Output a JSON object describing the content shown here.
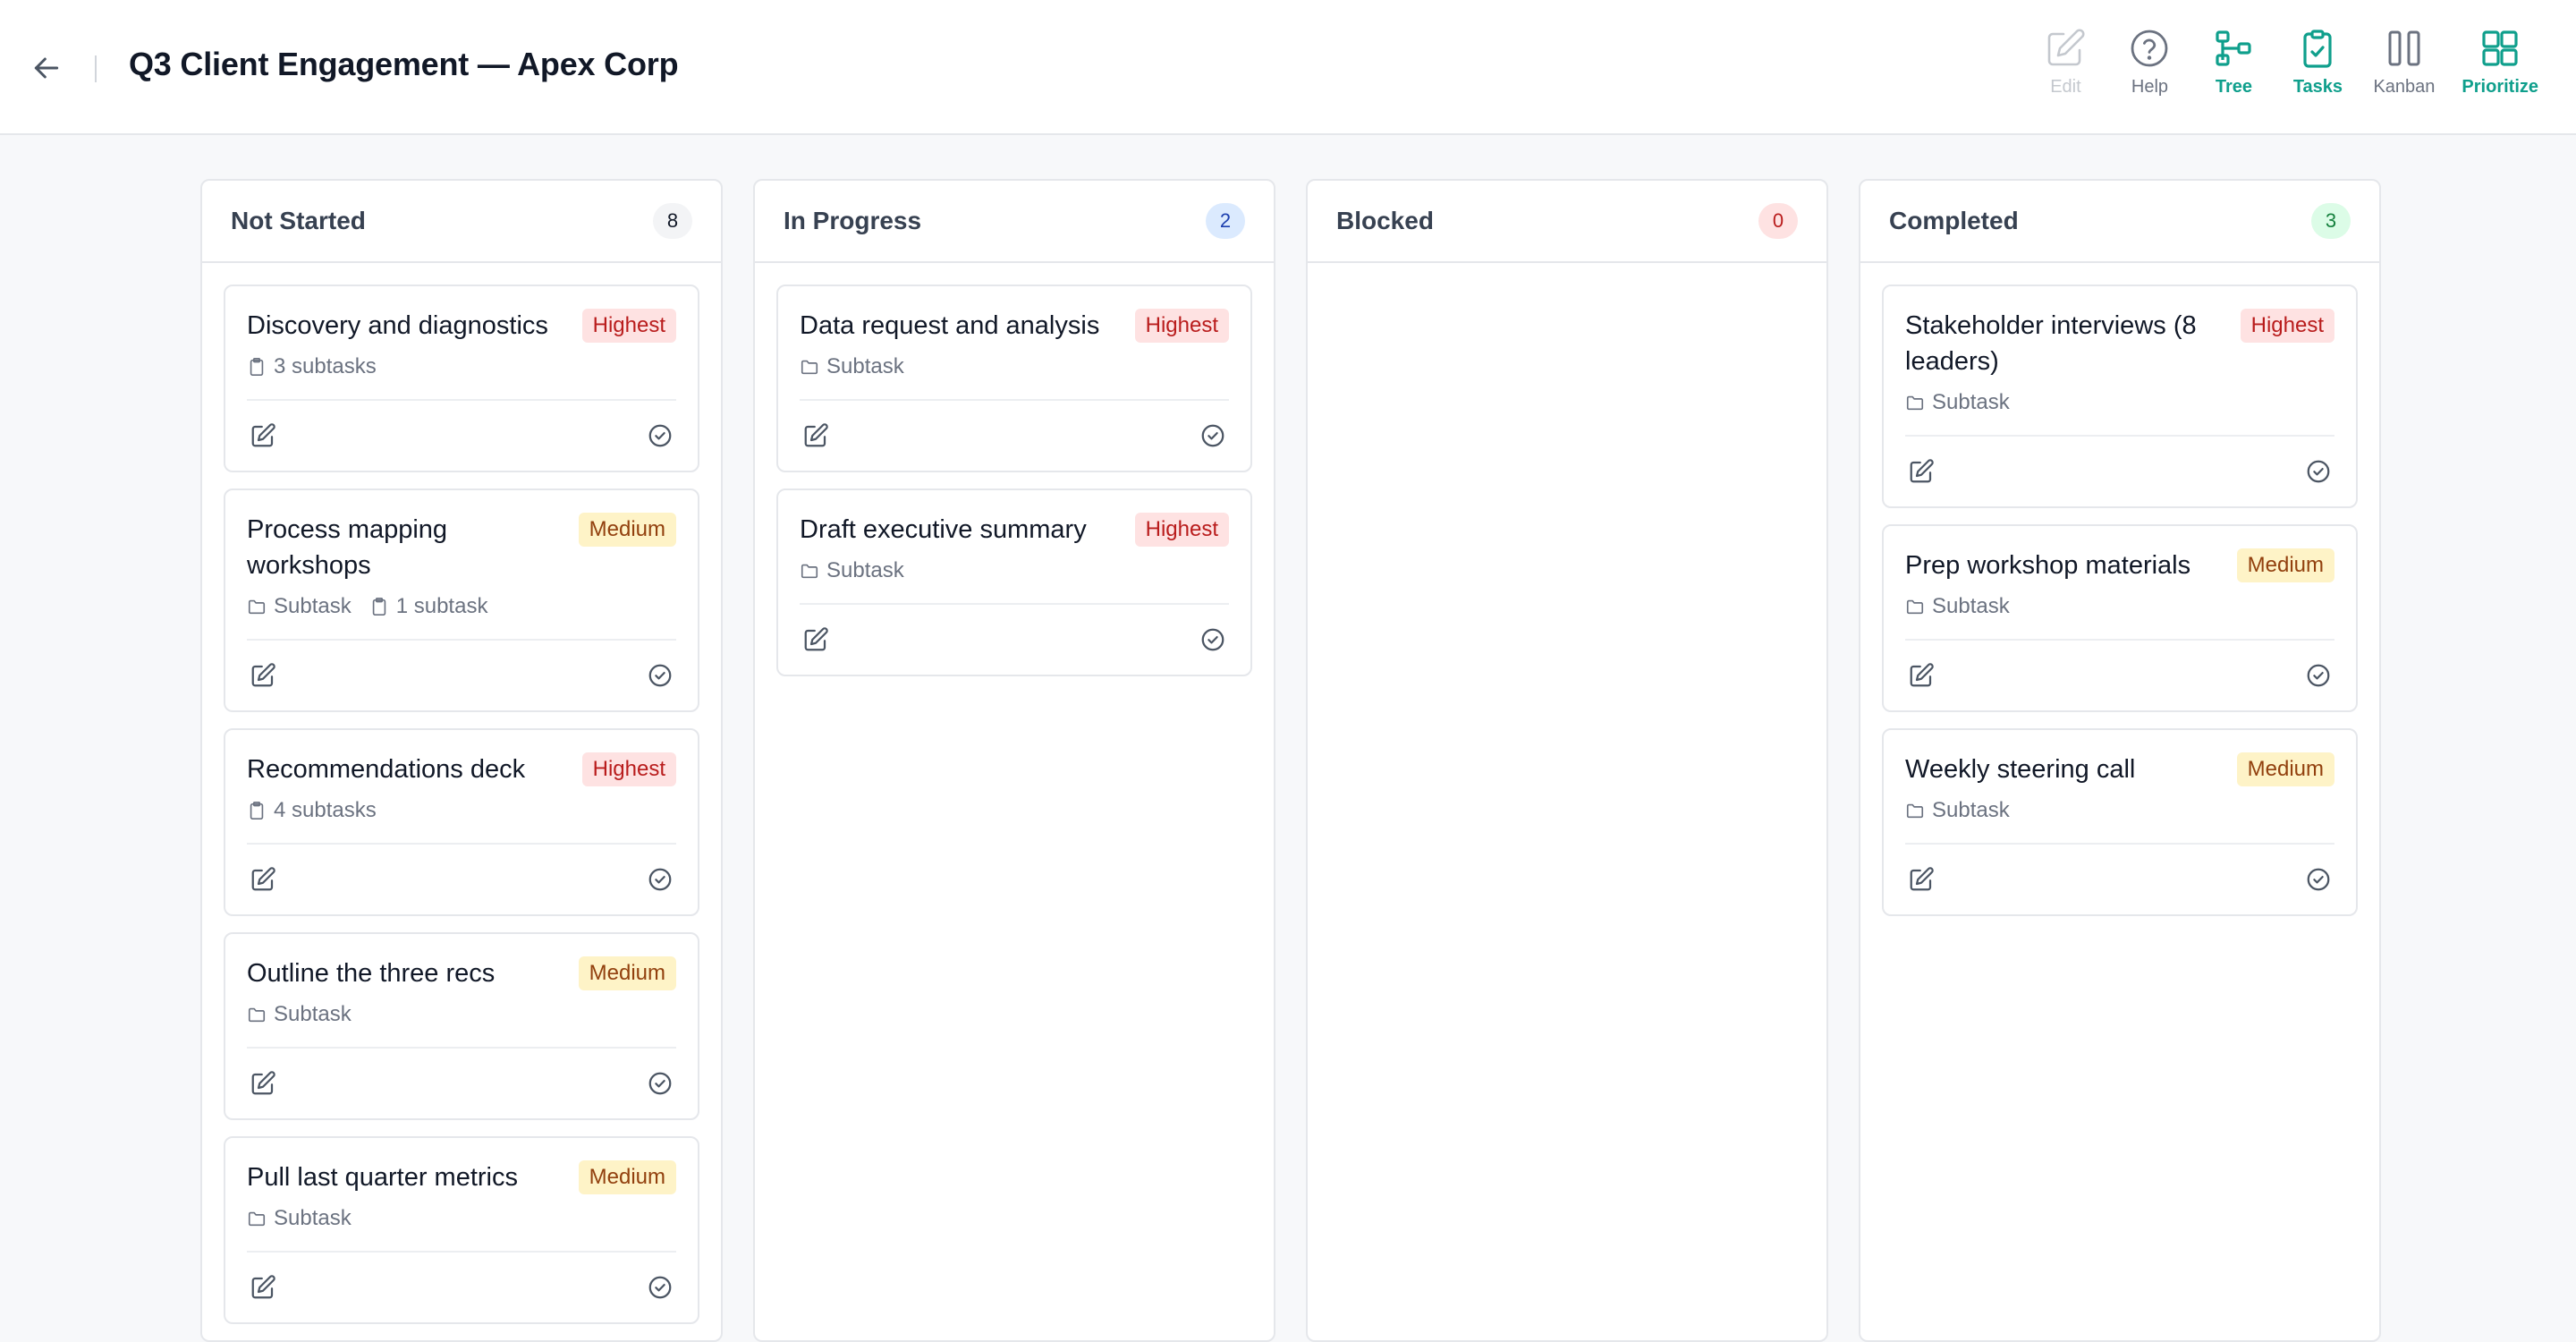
{
  "header": {
    "title": "Q3 Client Engagement — Apex Corp",
    "toolbar": [
      {
        "label": "Edit",
        "icon": "edit-icon",
        "state": "disabled"
      },
      {
        "label": "Help",
        "icon": "help-icon",
        "state": "normal"
      },
      {
        "label": "Tree",
        "icon": "tree-icon",
        "state": "accent"
      },
      {
        "label": "Tasks",
        "icon": "tasks-icon",
        "state": "accent"
      },
      {
        "label": "Kanban",
        "icon": "kanban-icon",
        "state": "normal"
      },
      {
        "label": "Prioritize",
        "icon": "prioritize-icon",
        "state": "accent"
      }
    ]
  },
  "colors": {
    "accent": "#0f9f8c",
    "highest_bg": "#fee2e2",
    "highest_text": "#b91c1c",
    "medium_bg": "#fef3c7",
    "medium_text": "#92400e"
  },
  "columns": [
    {
      "title": "Not Started",
      "count": "8",
      "count_style": "gray",
      "cards": [
        {
          "title": "Discovery and diagnostics",
          "priority": "Highest",
          "meta": [
            {
              "icon": "clipboard-icon",
              "text": "3 subtasks"
            }
          ]
        },
        {
          "title": "Process mapping workshops",
          "priority": "Medium",
          "meta": [
            {
              "icon": "folder-icon",
              "text": "Subtask"
            },
            {
              "icon": "clipboard-icon",
              "text": "1 subtask"
            }
          ]
        },
        {
          "title": "Recommendations deck",
          "priority": "Highest",
          "meta": [
            {
              "icon": "clipboard-icon",
              "text": "4 subtasks"
            }
          ]
        },
        {
          "title": "Outline the three recs",
          "priority": "Medium",
          "meta": [
            {
              "icon": "folder-icon",
              "text": "Subtask"
            }
          ]
        },
        {
          "title": "Pull last quarter metrics",
          "priority": "Medium",
          "meta": [
            {
              "icon": "folder-icon",
              "text": "Subtask"
            }
          ]
        }
      ]
    },
    {
      "title": "In Progress",
      "count": "2",
      "count_style": "blue",
      "cards": [
        {
          "title": "Data request and analysis",
          "priority": "Highest",
          "meta": [
            {
              "icon": "folder-icon",
              "text": "Subtask"
            }
          ]
        },
        {
          "title": "Draft executive summary",
          "priority": "Highest",
          "meta": [
            {
              "icon": "folder-icon",
              "text": "Subtask"
            }
          ]
        }
      ]
    },
    {
      "title": "Blocked",
      "count": "0",
      "count_style": "red",
      "cards": []
    },
    {
      "title": "Completed",
      "count": "3",
      "count_style": "green",
      "cards": [
        {
          "title": "Stakeholder interviews (8 leaders)",
          "priority": "Highest",
          "meta": [
            {
              "icon": "folder-icon",
              "text": "Subtask"
            }
          ]
        },
        {
          "title": "Prep workshop materials",
          "priority": "Medium",
          "meta": [
            {
              "icon": "folder-icon",
              "text": "Subtask"
            }
          ]
        },
        {
          "title": "Weekly steering call",
          "priority": "Medium",
          "meta": [
            {
              "icon": "folder-icon",
              "text": "Subtask"
            }
          ]
        }
      ]
    }
  ]
}
